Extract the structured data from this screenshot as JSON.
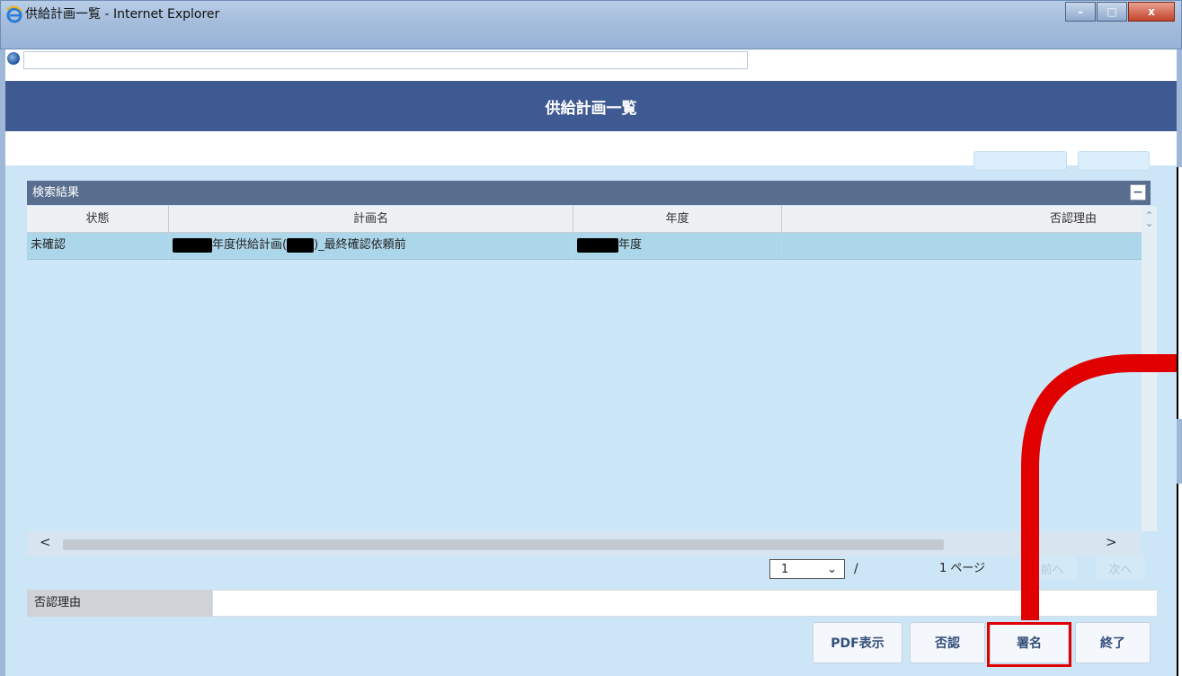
{
  "window": {
    "title": "供給計画一覧 - Internet Explorer",
    "controls": [
      "–",
      "□",
      "x"
    ]
  },
  "page": {
    "title": "供給計画一覧"
  },
  "results": {
    "header": "検索結果",
    "collapse_symbol": "−",
    "columns": [
      "状態",
      "計画名",
      "年度",
      "否認理由"
    ],
    "rows": [
      {
        "status": "未確認",
        "plan_name_a": "年度供給計画(",
        "plan_name_b": ")_最終確認依頼前",
        "year": "年度",
        "reason": ""
      }
    ]
  },
  "scrollbar": {
    "up": "⌃",
    "down": "⌄",
    "left": "<",
    "right": ">"
  },
  "pager": {
    "current_page": "1",
    "select_caret": "⌄",
    "slash": "/",
    "total": "1 ページ",
    "prev": "前へ",
    "next": "次へ"
  },
  "reason": {
    "label": "否認理由",
    "value": ""
  },
  "buttons": {
    "pdf": "PDF表示",
    "reject": "否認",
    "sign": "署名",
    "close": "終了"
  },
  "colors": {
    "header_bg": "#3f5a93",
    "content_bg": "#cce6f7",
    "annotation": "#e00000"
  }
}
